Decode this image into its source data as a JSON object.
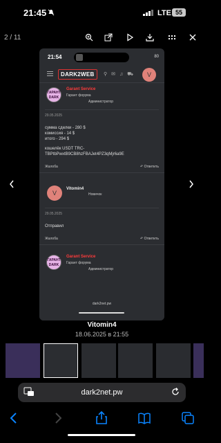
{
  "status": {
    "time": "21:45",
    "network": "LTE",
    "battery": "55"
  },
  "viewer": {
    "counter": "2 / 11"
  },
  "inner": {
    "time": "21:54",
    "battery": "80",
    "logo": "DARK2WEB",
    "avatar_letter": "V",
    "posts": [
      {
        "author": "Garant Service",
        "role": "Гарант форума",
        "group": "Администратор",
        "badge": "ГАРАНТ DARK",
        "date": "29.05.2025",
        "lines": [
          "сумма сделки - 280 $",
          "комиссия - 14 $",
          "итого - 294 $",
          "",
          "кошелёк USDT TRC-",
          "TBPtbPwxtB9CB8hzFBAJet4PZ3qMjr6a9E"
        ],
        "report": "Жалоба",
        "reply": "Ответить"
      },
      {
        "author": "Vitomin4",
        "avatar_letter": "V",
        "group": "Новичок",
        "date": "29.05.2025",
        "lines": [
          "Отправил"
        ],
        "report": "Жалоба",
        "reply": "Ответить"
      },
      {
        "author": "Garant Service",
        "role": "Гарант форума",
        "group": "Администратор",
        "badge": "ГАРАНТ DARK"
      }
    ],
    "site_url": "dark2net.pw"
  },
  "caption": {
    "name": "Vitomin4",
    "date": "18.06.2025 в 21:55"
  },
  "safari": {
    "url": "dark2net.pw"
  },
  "colors": {
    "accent": "#0a84ff",
    "username_red": "#ff3b3b",
    "avatar": "#e0827a"
  }
}
